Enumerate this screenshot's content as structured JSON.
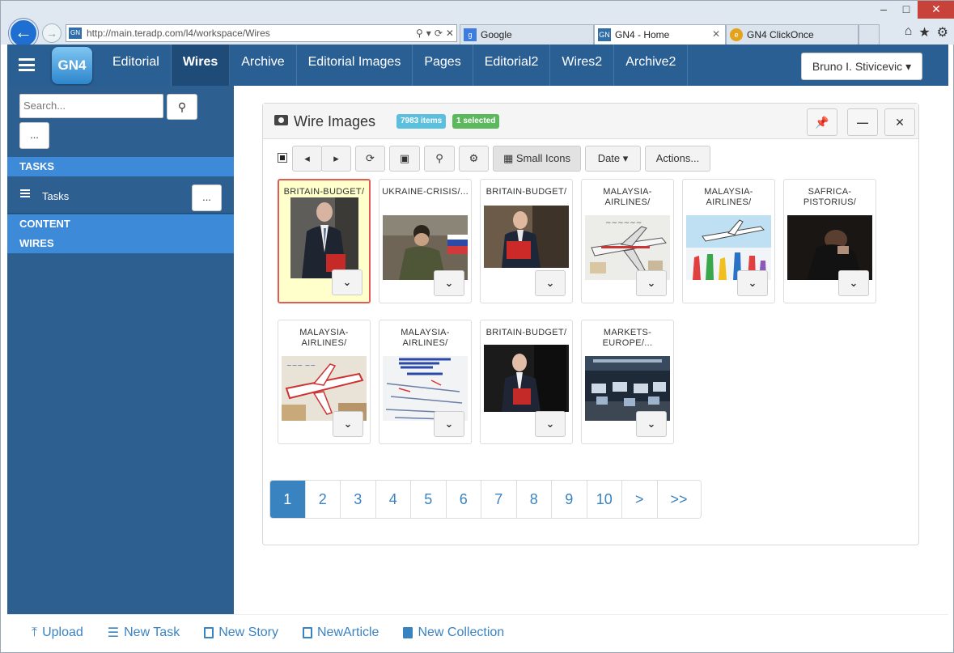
{
  "browser": {
    "window_controls": [
      "–",
      "□",
      "✕"
    ],
    "address": "http://main.teradp.com/l4/workspace/Wires",
    "tabs": [
      {
        "label": "Google",
        "icon": "google-icon",
        "active": false
      },
      {
        "label": "GN4 - Home",
        "icon": "gn4-icon",
        "active": true
      },
      {
        "label": "GN4 ClickOnce",
        "icon": "ie-icon",
        "active": false
      }
    ]
  },
  "app": {
    "logo": "GN4",
    "nav": [
      "Editorial",
      "Wires",
      "Archive",
      "Editorial Images",
      "Pages",
      "Editorial2",
      "Wires2",
      "Archive2"
    ],
    "active_nav": "Wires",
    "user": "Bruno I. Stivicevic"
  },
  "sidebar": {
    "search_placeholder": "Search...",
    "more_label": "...",
    "tasks_header": "TASKS",
    "tasks_item": "Tasks",
    "tasks_more": "...",
    "content_header": "CONTENT",
    "wires_header": "WIRES"
  },
  "panel": {
    "title": "Wire Images",
    "count_badge": "7983 items",
    "selected_badge": "1 selected",
    "toolbar": {
      "view_label": "Small Icons",
      "sort_label": "Date",
      "actions_label": "Actions..."
    },
    "items": [
      {
        "caption": "BRITAIN-BUDGET/",
        "selected": true
      },
      {
        "caption": "UKRAINE-CRISIS/...",
        "selected": false
      },
      {
        "caption": "BRITAIN-BUDGET/",
        "selected": false
      },
      {
        "caption": "MALAYSIA-AIRLINES/",
        "selected": false
      },
      {
        "caption": "MALAYSIA-AIRLINES/",
        "selected": false
      },
      {
        "caption": "SAFRICA-PISTORIUS/",
        "selected": false
      },
      {
        "caption": "MALAYSIA-AIRLINES/",
        "selected": false
      },
      {
        "caption": "MALAYSIA-AIRLINES/",
        "selected": false
      },
      {
        "caption": "BRITAIN-BUDGET/",
        "selected": false
      },
      {
        "caption": "MARKETS-EUROPE/...",
        "selected": false
      }
    ],
    "pagination": [
      "1",
      "2",
      "3",
      "4",
      "5",
      "6",
      "7",
      "8",
      "9",
      "10",
      ">",
      ">>"
    ],
    "current_page": "1"
  },
  "footer": {
    "upload": "Upload",
    "new_task": "New Task",
    "new_story": "New Story",
    "new_article": "NewArticle",
    "new_collection": "New Collection"
  },
  "colors": {
    "navbar": "#2a5f94",
    "sidebar": "#2d6091",
    "section_header": "#3d8ad8",
    "link": "#3a83c1",
    "badge_info": "#5bc0de",
    "badge_success": "#5cb85c",
    "selected_item_bg": "#ffffcc",
    "selected_item_border": "#e25b5b"
  }
}
